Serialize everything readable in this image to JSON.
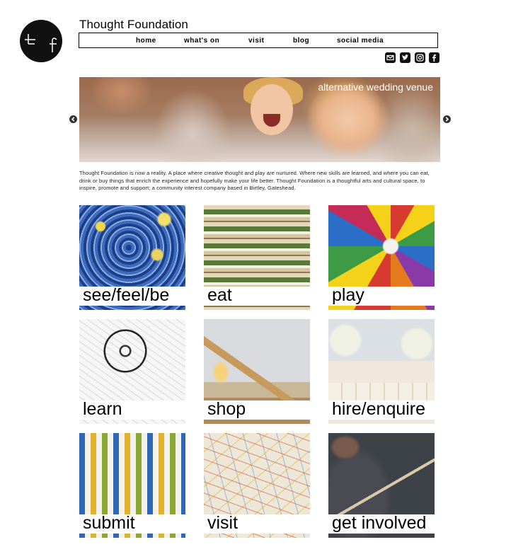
{
  "site": {
    "title": "Thought Foundation"
  },
  "nav": [
    {
      "label": "home"
    },
    {
      "label": "what's on"
    },
    {
      "label": "visit"
    },
    {
      "label": "blog"
    },
    {
      "label": "social media"
    }
  ],
  "social_icons": [
    "email-icon",
    "twitter-icon",
    "instagram-icon",
    "facebook-icon"
  ],
  "slider": {
    "caption": "alternative wedding venue"
  },
  "intro_text": "Thought Foundation is now a reality. A place where creative thought and play are nurtured. Where new skills are learned, and where you can eat, drink or buy things that enrich the experience and hopefully make your life better. Thought Foundation is a thoughtful arts and cultural space, to inspire, promote and support; a community interest company based in Birtley, Gateshead.",
  "tiles": [
    {
      "label": "see/feel/be"
    },
    {
      "label": "eat"
    },
    {
      "label": "play"
    },
    {
      "label": "learn"
    },
    {
      "label": "shop"
    },
    {
      "label": "hire/enquire"
    },
    {
      "label": "submit"
    },
    {
      "label": "visit"
    },
    {
      "label": "get involved"
    }
  ],
  "colors": {
    "background": "#ffffff",
    "text": "#000000",
    "logo": "#111111"
  }
}
